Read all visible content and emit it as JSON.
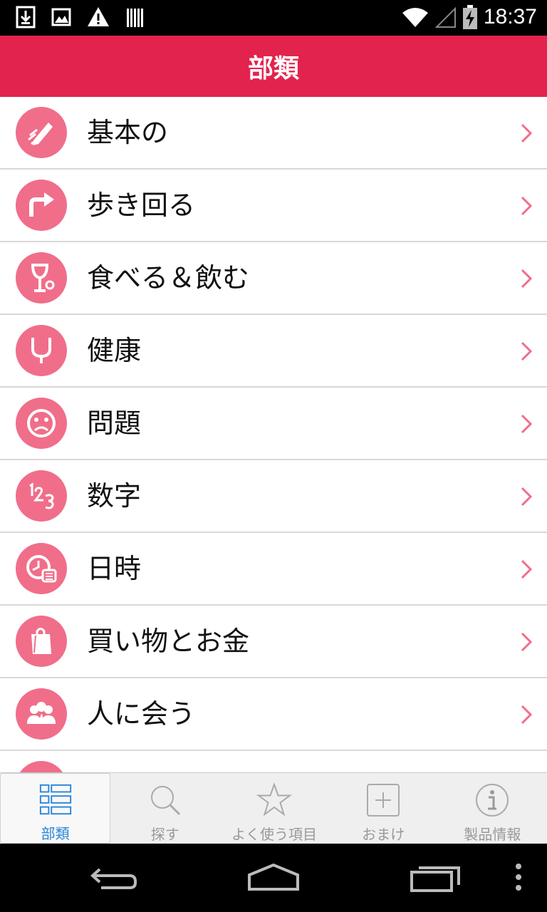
{
  "status_bar": {
    "time": "18:37",
    "left_icons": [
      "download-icon",
      "image-icon",
      "warning-icon",
      "barcode-icon"
    ],
    "right_icons": [
      "wifi-icon",
      "signal-icon",
      "battery-charging-icon"
    ]
  },
  "header": {
    "title": "部類"
  },
  "categories": [
    {
      "label": "基本の",
      "icon": "pencil-icon"
    },
    {
      "label": "歩き回る",
      "icon": "turn-arrow-icon"
    },
    {
      "label": "食べる＆飲む",
      "icon": "wine-glass-icon"
    },
    {
      "label": "健康",
      "icon": "stethoscope-icon"
    },
    {
      "label": "問題",
      "icon": "sad-face-icon"
    },
    {
      "label": "数字",
      "icon": "numbers-icon"
    },
    {
      "label": "日時",
      "icon": "clock-calendar-icon"
    },
    {
      "label": "買い物とお金",
      "icon": "shopping-bag-icon"
    },
    {
      "label": "人に会う",
      "icon": "people-icon"
    }
  ],
  "tabs": [
    {
      "label": "部類",
      "icon": "list-icon",
      "active": true
    },
    {
      "label": "探す",
      "icon": "search-icon",
      "active": false
    },
    {
      "label": "よく使う項目",
      "icon": "star-icon",
      "active": false
    },
    {
      "label": "おまけ",
      "icon": "plus-box-icon",
      "active": false
    },
    {
      "label": "製品情報",
      "icon": "info-icon",
      "active": false
    }
  ],
  "colors": {
    "header": "#e2234e",
    "icon_bg": "#f06e8a",
    "chevron": "#f06e8a",
    "active_tab": "#2a86d8",
    "inactive_tab": "#999999"
  },
  "nav_bar": [
    "back-icon",
    "home-icon",
    "recent-apps-icon",
    "menu-icon"
  ]
}
